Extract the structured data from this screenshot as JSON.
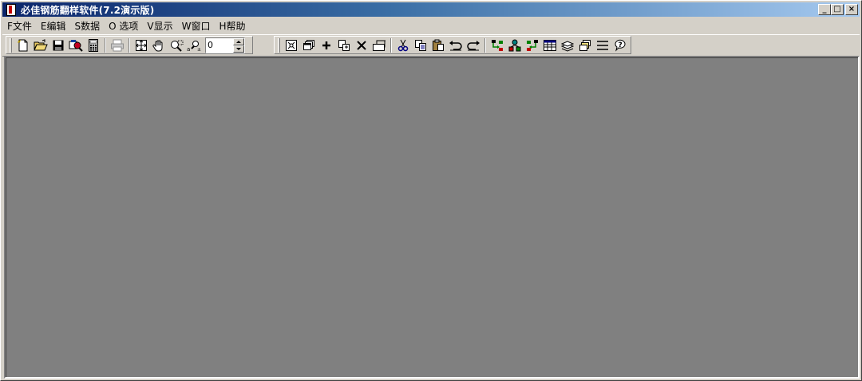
{
  "window": {
    "title": "必佳钢筋翻样软件(7.2演示版)",
    "minimize_label": "_",
    "maximize_label": "□",
    "close_label": "×"
  },
  "menu": [
    {
      "label": "F文件"
    },
    {
      "label": "E编辑"
    },
    {
      "label": "S数据"
    },
    {
      "label": "O 选项"
    },
    {
      "label": "V显示"
    },
    {
      "label": "W窗口"
    },
    {
      "label": "H帮助"
    }
  ],
  "toolbar": {
    "zoom_value": "0"
  },
  "colors": {
    "title_start": "#0a246a",
    "title_end": "#a6caf0",
    "face": "#d4d0c8",
    "mdi_background": "#808080"
  },
  "icons": {
    "tb1": [
      "new-file-icon",
      "open-folder-icon",
      "save-icon",
      "print-preview-icon",
      "calculator-icon",
      "print-icon",
      "zoom-extents-icon",
      "pan-hand-icon",
      "zoom-window-icon",
      "zoom-realtime-icon"
    ],
    "tb2": [
      "select-window-icon",
      "cascade-windows-icon",
      "add-icon",
      "copy-object-icon",
      "delete-icon",
      "move-object-icon",
      "cut-icon",
      "copy-icon",
      "paste-icon",
      "undo-icon",
      "redo-icon",
      "export-icon",
      "network-icon",
      "import-icon",
      "table-icon",
      "layers-icon",
      "stack-icon",
      "list-lines-icon",
      "help-icon"
    ]
  }
}
